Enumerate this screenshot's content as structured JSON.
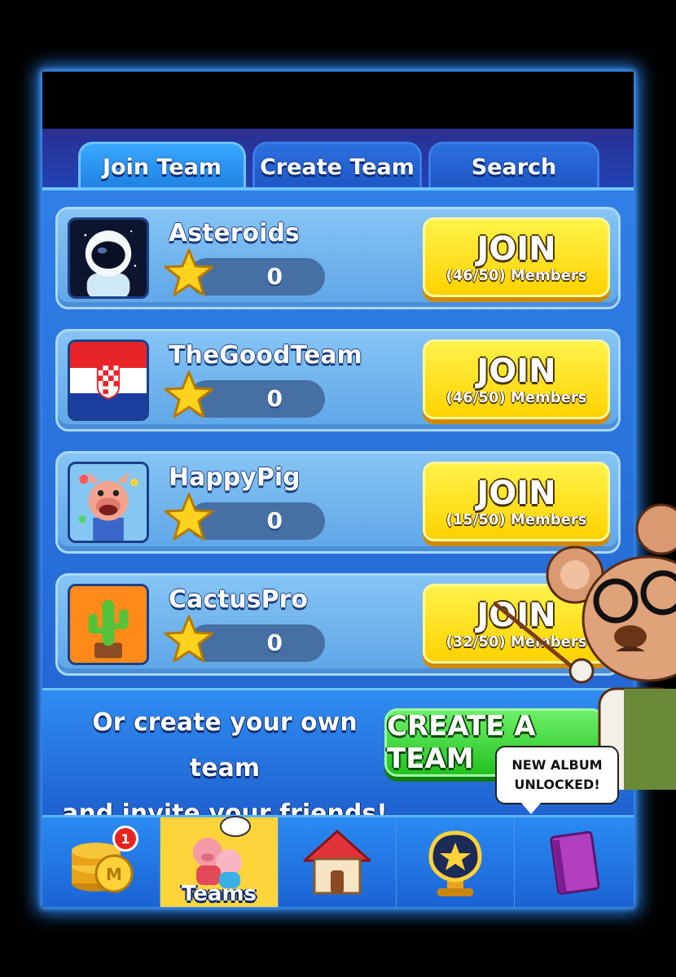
{
  "tabs": [
    {
      "label": "Join Team",
      "active": true
    },
    {
      "label": "Create Team",
      "active": false
    },
    {
      "label": "Search",
      "active": false
    }
  ],
  "teams": [
    {
      "name": "Asteroids",
      "score": "0",
      "join_label": "JOIN",
      "members": "(46/50) Members",
      "avatar": "astronaut-icon"
    },
    {
      "name": "TheGoodTeam",
      "score": "0",
      "join_label": "JOIN",
      "members": "(46/50) Members",
      "avatar": "croatia-flag-icon"
    },
    {
      "name": "HappyPig",
      "score": "0",
      "join_label": "JOIN",
      "members": "(15/50) Members",
      "avatar": "pig-icon"
    },
    {
      "name": "CactusPro",
      "score": "0",
      "join_label": "JOIN",
      "members": "(32/50) Members",
      "avatar": "cactus-icon"
    }
  ],
  "create_panel": {
    "line1": "Or create your own team",
    "line2": "and invite your friends!",
    "button_label": "CREATE A TEAM"
  },
  "notification": {
    "line1": "NEW ALBUM",
    "line2": "UNLOCKED!"
  },
  "nav": [
    {
      "icon": "coins-icon",
      "badge": "1",
      "label": ""
    },
    {
      "icon": "teams-icon",
      "label": "Teams",
      "active": true
    },
    {
      "icon": "home-icon",
      "label": ""
    },
    {
      "icon": "trophy-star-icon",
      "label": ""
    },
    {
      "icon": "album-book-icon",
      "label": ""
    }
  ],
  "colors": {
    "join_yellow": "#ffe01a",
    "create_green": "#3ad836",
    "panel_blue": "#2568d4",
    "glow": "#2d8cff"
  }
}
